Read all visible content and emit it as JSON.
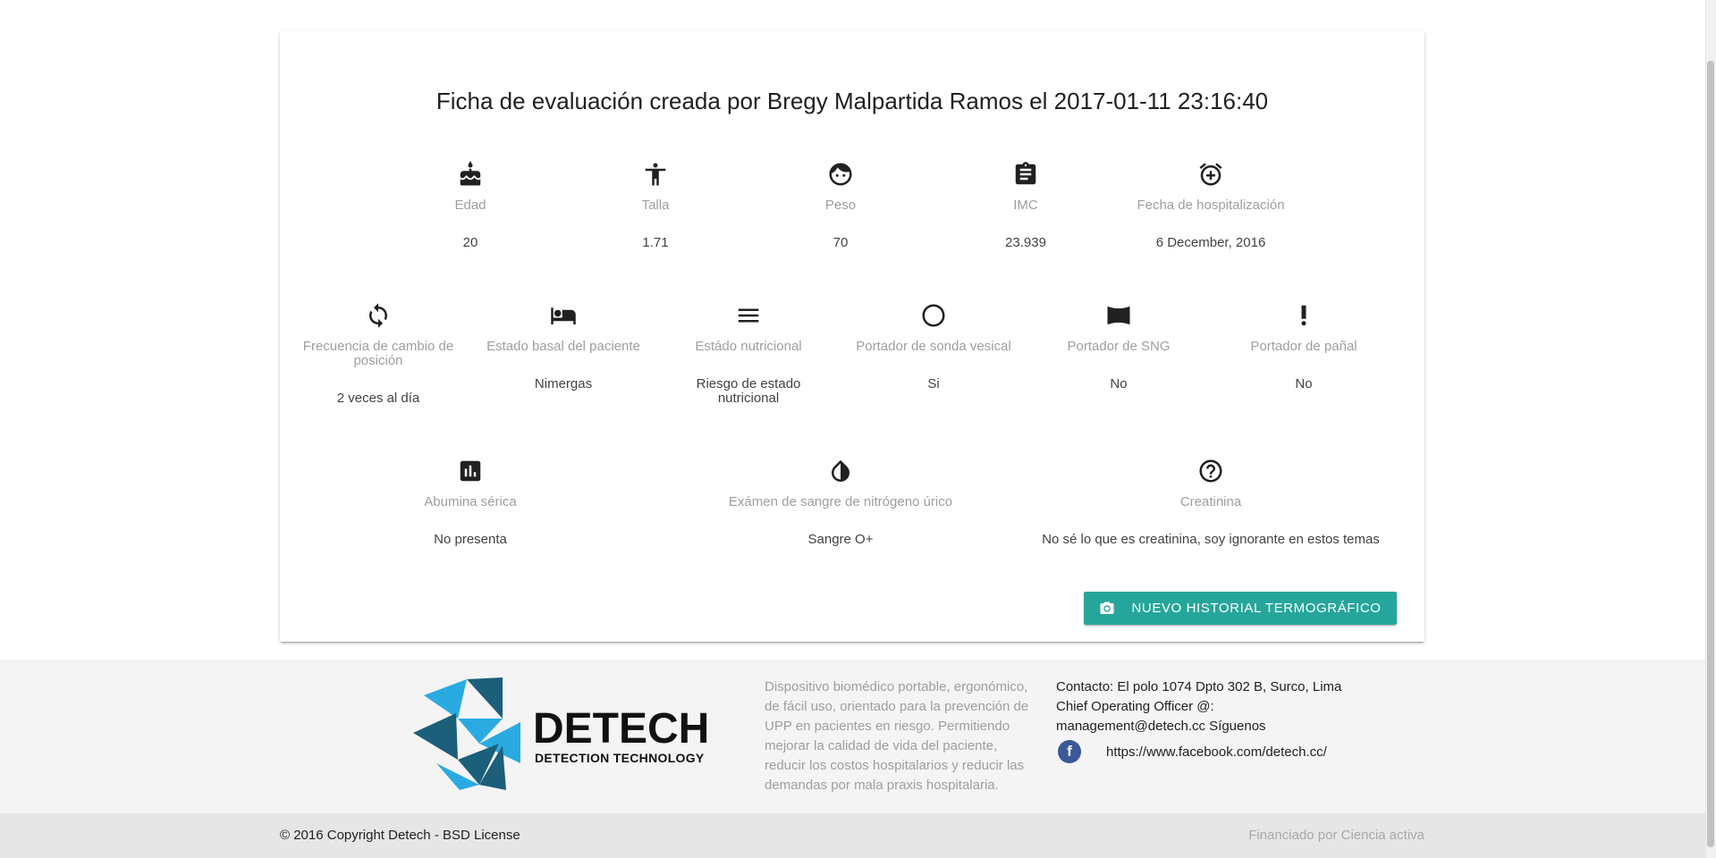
{
  "card": {
    "title": "Ficha de evaluación creada por Bregy Malpartida Ramos el 2017-01-11 23:16:40",
    "row1": [
      {
        "icon": "cake-icon",
        "label": "Edad",
        "value": "20"
      },
      {
        "icon": "accessibility-icon",
        "label": "Talla",
        "value": "1.71"
      },
      {
        "icon": "face-icon",
        "label": "Peso",
        "value": "70"
      },
      {
        "icon": "clipboard-icon",
        "label": "IMC",
        "value": "23.939"
      },
      {
        "icon": "alarm-add-icon",
        "label": "Fecha de hospitalización",
        "value": "6 December, 2016"
      }
    ],
    "row2": [
      {
        "icon": "sync-icon",
        "label": "Frecuencia de cambio de posición",
        "value": "2 veces al día"
      },
      {
        "icon": "hotel-bed-icon",
        "label": "Estado basal del paciente",
        "value": "Nimergas"
      },
      {
        "icon": "menu-lines-icon",
        "label": "Estádo nutricional",
        "value": "Riesgo de estado nutricional"
      },
      {
        "icon": "circle-outline-icon",
        "label": "Portador de sonda vesical",
        "value": "Si"
      },
      {
        "icon": "panorama-icon",
        "label": "Portador de SNG",
        "value": "No"
      },
      {
        "icon": "priority-high-icon",
        "label": "Portador de pañal",
        "value": "No"
      }
    ],
    "row3": [
      {
        "icon": "assessment-icon",
        "label": "Abumina sérica",
        "value": "No presenta"
      },
      {
        "icon": "invert-colors-icon",
        "label": "Exámen de sangre de nitrógeno úrico",
        "value": "Sangre O+"
      },
      {
        "icon": "help-outline-icon",
        "label": "Creatinina",
        "value": "No sé lo que es creatinina, soy ignorante en estos temas"
      }
    ],
    "button_label": "Nuevo historial termográfico",
    "button_icon": "camera-icon"
  },
  "footer": {
    "logo_word": "DETECH",
    "logo_sub": "DETECTION TECHNOLOGY",
    "description": "Dispositivo biomédico portable, ergonómico, de fácil uso, orientado para la prevención de UPP en pacientes en riesgo. Permitiendo mejorar la calidad de vida del paciente, reducir los costos hospitalarios y reducir las demandas por mala praxis hospitalaria.",
    "contact": "Contacto: El polo 1074 Dpto 302 B, Surco, Lima Chief Operating Officer @: management@detech.cc Síguenos",
    "facebook_letter": "f",
    "facebook_url": "https://www.facebook.com/detech.cc/",
    "copyright": "© 2016 Copyright Detech - BSD License",
    "funded": "Financiado por Ciencia activa"
  },
  "colors": {
    "accent": "#26a69a",
    "logo_light": "#29abe2",
    "logo_dark": "#1b5f7a",
    "facebook": "#3b5998"
  }
}
